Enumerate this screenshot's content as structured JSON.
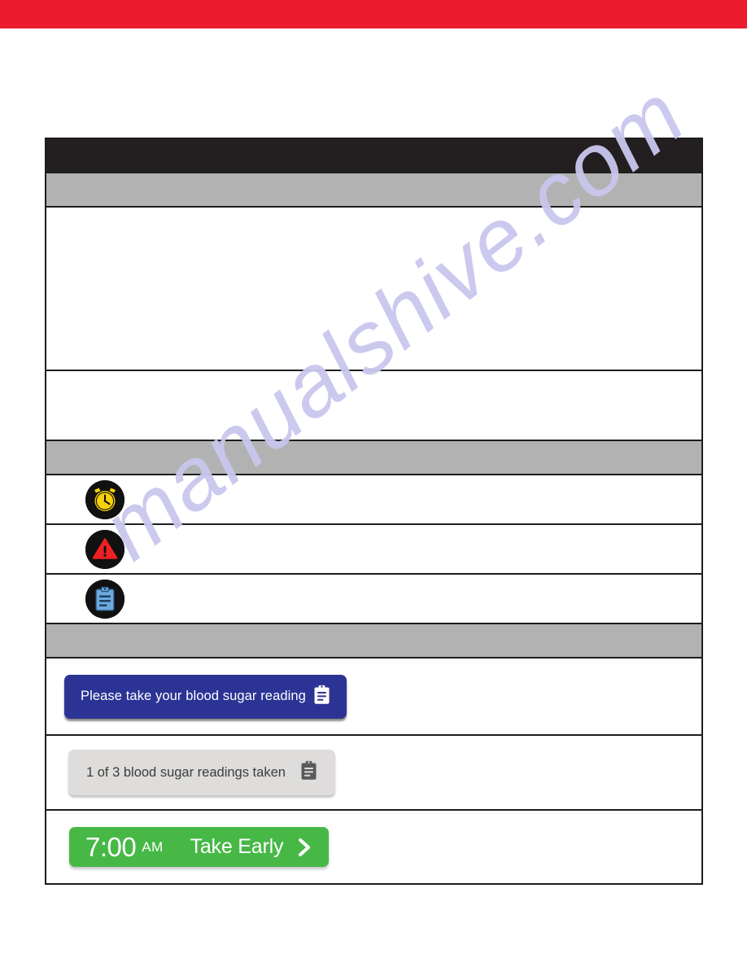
{
  "page": {
    "banner_color": "#ec1b2e",
    "watermark_text": "manualshive.com",
    "watermark_color": "#c9c7ee"
  },
  "table": {
    "header_bar_color": "#231f20",
    "section_bar_color": "#b2b2b2",
    "rows": [
      {
        "type": "title-bar",
        "label": ""
      },
      {
        "type": "section-bar",
        "label": ""
      },
      {
        "type": "blank-tall",
        "label": ""
      },
      {
        "type": "blank-med",
        "label": ""
      },
      {
        "type": "section-bar",
        "label": ""
      },
      {
        "type": "icon",
        "icon": "alarm-clock-icon",
        "label": ""
      },
      {
        "type": "icon",
        "icon": "warning-triangle-icon",
        "label": ""
      },
      {
        "type": "icon",
        "icon": "clipboard-icon",
        "label": ""
      },
      {
        "type": "section-bar",
        "label": ""
      }
    ]
  },
  "buttons": {
    "blue": {
      "label": "Please take your blood sugar reading",
      "icon": "clipboard-icon",
      "bg": "#2b3494",
      "fg": "#ffffff"
    },
    "gray": {
      "label": "1 of 3 blood sugar readings taken",
      "icon": "clipboard-icon",
      "bg": "#dedddb",
      "fg": "#3c3c3c"
    },
    "green": {
      "time": "7:00",
      "meridiem": "AM",
      "action_label": "Take Early",
      "icon": "chevron-right-icon",
      "bg": "#47b846",
      "fg": "#ffffff"
    }
  }
}
